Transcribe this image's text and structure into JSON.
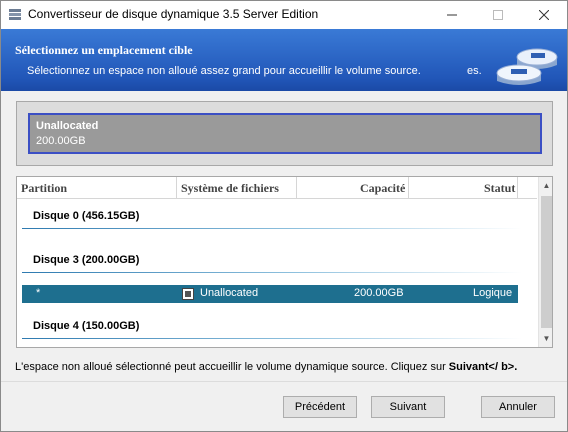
{
  "window": {
    "title": "Convertisseur de disque dynamique 3.5 Server Edition"
  },
  "header": {
    "title": "Sélectionnez un emplacement cible",
    "subtitle": "Sélectionnez un espace non alloué assez grand pour accueillir le volume source.",
    "subtitle_tail": "es."
  },
  "target": {
    "name": "Unallocated",
    "size": "200.00GB"
  },
  "table": {
    "columns": [
      "Partition",
      "Système de fichiers",
      "Capacité",
      "Statut"
    ],
    "disks": [
      {
        "label": "Disque 0 (456.15GB)"
      },
      {
        "label": "Disque 3 (200.00GB)"
      },
      {
        "label": "Disque 4 (150.00GB)"
      }
    ],
    "selected_row": {
      "partition": "*",
      "filesystem": "Unallocated",
      "capacity": "200.00GB",
      "status": "Logique"
    }
  },
  "footer": {
    "info_text": "L'espace non alloué sélectionné peut accueillir le volume dynamique source. Cliquez sur ",
    "info_bold": "Suivant</ b>.",
    "prev_label": "Précédent",
    "next_label": "Suivant",
    "cancel_label": "Annuler"
  },
  "colors": {
    "header_blue": "#2156b8",
    "selected_row": "#1e6f8f",
    "target_border": "#3b4fc4"
  },
  "icons": [
    "app-icon",
    "minimize-icon",
    "maximize-icon",
    "close-icon",
    "disk-drives-icon",
    "scroll-up-icon",
    "scroll-down-icon"
  ]
}
